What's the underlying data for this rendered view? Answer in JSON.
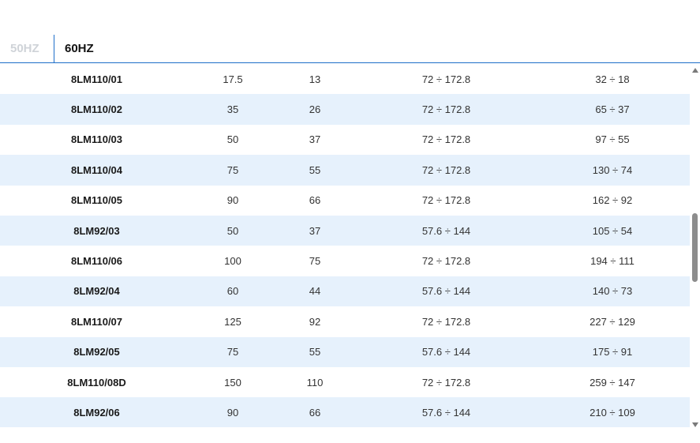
{
  "tabs": [
    {
      "label": "50HZ",
      "active": false
    },
    {
      "label": "60HZ",
      "active": true
    }
  ],
  "rows": [
    [
      "8LM110/01",
      "17.5",
      "13",
      "72 ÷ 172.8",
      "32 ÷ 18"
    ],
    [
      "8LM110/02",
      "35",
      "26",
      "72 ÷ 172.8",
      "65 ÷ 37"
    ],
    [
      "8LM110/03",
      "50",
      "37",
      "72 ÷ 172.8",
      "97 ÷ 55"
    ],
    [
      "8LM110/04",
      "75",
      "55",
      "72 ÷ 172.8",
      "130 ÷ 74"
    ],
    [
      "8LM110/05",
      "90",
      "66",
      "72 ÷ 172.8",
      "162 ÷ 92"
    ],
    [
      "8LM92/03",
      "50",
      "37",
      "57.6 ÷ 144",
      "105 ÷ 54"
    ],
    [
      "8LM110/06",
      "100",
      "75",
      "72 ÷ 172.8",
      "194 ÷ 111"
    ],
    [
      "8LM92/04",
      "60",
      "44",
      "57.6 ÷ 144",
      "140 ÷ 73"
    ],
    [
      "8LM110/07",
      "125",
      "92",
      "72 ÷ 172.8",
      "227 ÷ 129"
    ],
    [
      "8LM92/05",
      "75",
      "55",
      "57.6 ÷ 144",
      "175 ÷ 91"
    ],
    [
      "8LM110/08D",
      "150",
      "110",
      "72 ÷ 172.8",
      "259 ÷ 147"
    ],
    [
      "8LM92/06",
      "90",
      "66",
      "57.6 ÷ 144",
      "210 ÷ 109"
    ]
  ],
  "colors": {
    "accent": "#1f6fc9",
    "row_alt": "#e6f1fc",
    "tab_inactive": "#cfd3d8"
  }
}
